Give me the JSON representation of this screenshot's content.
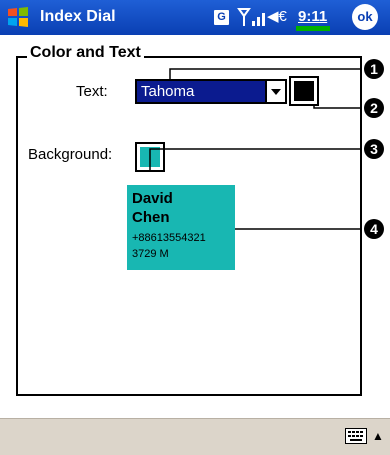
{
  "app": {
    "title": "Index Dial",
    "time": "9:11",
    "ok_label": "ok",
    "g_icon": "G"
  },
  "group": {
    "title": "Color and Text"
  },
  "text_row": {
    "label": "Text:",
    "font_value": "Tahoma"
  },
  "background_row": {
    "label": "Background:"
  },
  "preview": {
    "name_line1": "David",
    "name_line2": "Chen",
    "phone": "+88613554321",
    "address": "3729 M"
  },
  "callouts": [
    "1",
    "2",
    "3",
    "4"
  ],
  "colors": {
    "text_color": "#000000",
    "background_color": "#18b7b2",
    "titlebar": "#0a3fb3"
  }
}
